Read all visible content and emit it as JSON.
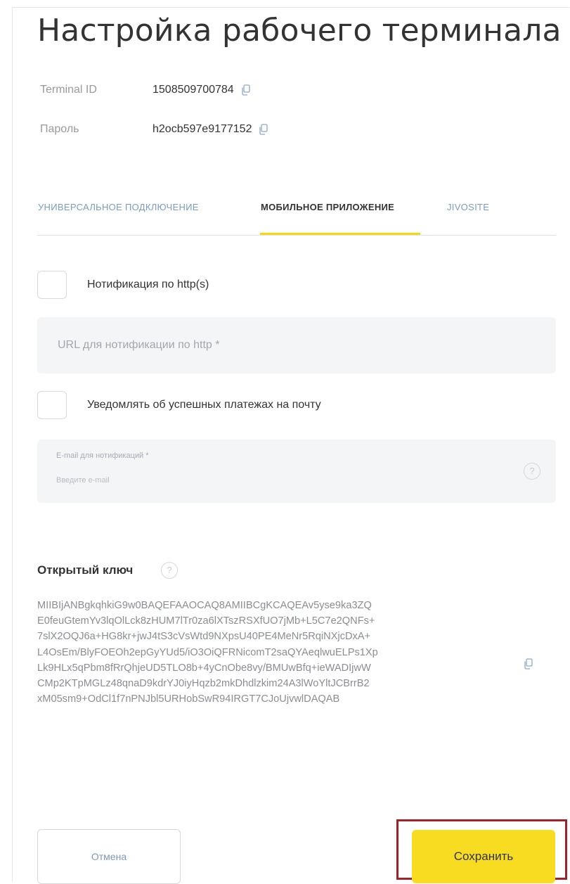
{
  "page": {
    "title": "Настройка рабочего терминала"
  },
  "credentials": {
    "terminal_id_label": "Terminal ID",
    "terminal_id_value": "1508509700784",
    "password_label": "Пароль",
    "password_value": "h2ocb597e9177152"
  },
  "tabs": [
    {
      "label": "УНИВЕРСАЛЬНОЕ ПОДКЛЮЧЕНИЕ",
      "active": false
    },
    {
      "label": "МОБИЛЬНОЕ ПРИЛОЖЕНИЕ",
      "active": true
    },
    {
      "label": "JIVOSITE",
      "active": false
    }
  ],
  "http_notification": {
    "checkbox_label": "Нотификация по http(s)",
    "checked": false,
    "url_placeholder": "URL для нотификации по http *"
  },
  "email_notification": {
    "checkbox_label": "Уведомлять об успешных платежах на почту",
    "checked": false,
    "field_label": "E-mail для нотификаций *",
    "field_placeholder": "Введите e-mail"
  },
  "public_key": {
    "heading": "Открытый ключ",
    "lines": [
      "MIIBIjANBgkqhkiG9w0BAQEFAAOCAQ8AMIIBCgKCAQEAv5yse9ka3ZQ",
      "E0feuGtemYv3lqOlLck8zHUM7lTr0za6lXTszRSXfUO7jMb+L5C7e2QNFs+",
      "7slX2OQJ6a+HG8kr+jwJ4tS3cVsWtd9NXpsU40PE4MeNr5RqiNXjcDxA+",
      "L4OsEm/BlyFOEOh2epGyYUd5/iO3OiQFRNicomT2saQYAeqlwuELPs1Xp",
      "Lk9HLx5qPbm8fRrQhjeUD5TLO8b+4yCnObe8vy/BMUwBfq+ieWADIjwW",
      "CMp2KTpMGLz48qnaD9kdrYJ0iyHqzb2mkDhdlzkim24A3lWoYltJCBrrB2",
      "xM05sm9+OdCl1f7nPNJbl5URHobSwR94IRGT7CJoUjvwlDAQAB"
    ]
  },
  "buttons": {
    "cancel": "Отмена",
    "save": "Сохранить"
  },
  "colors": {
    "accent_yellow": "#f7dc22",
    "tab_inactive": "#7a9cc0",
    "highlight_border": "#a3222a"
  }
}
